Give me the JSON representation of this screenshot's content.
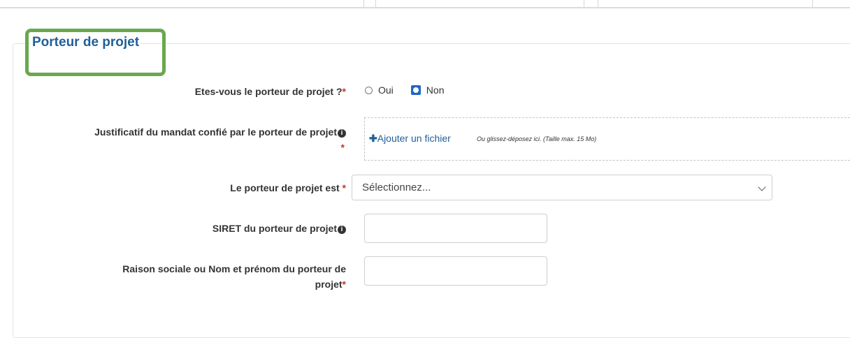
{
  "section": {
    "title": "Porteur de projet"
  },
  "fields": {
    "is_porteur": {
      "label": "Etes-vous le porteur de projet ?",
      "required_mark": "*",
      "options": [
        {
          "label": "Oui",
          "checked": false
        },
        {
          "label": "Non",
          "checked": true
        }
      ]
    },
    "justificatif": {
      "label": "Justificatif du mandat confié par le porteur de projet",
      "required_mark": "*",
      "add_file_label": "Ajouter un fichier",
      "add_file_icon": "plus-icon",
      "drop_hint": "Ou glissez-déposez ici. (Taille max. 15 Mo)"
    },
    "porteur_type": {
      "label": "Le porteur de projet est",
      "required_mark": "*",
      "select_value": "Sélectionnez..."
    },
    "siret": {
      "label": "SIRET du porteur de projet",
      "value": ""
    },
    "raison_sociale": {
      "label_line1": "Raison sociale ou Nom et prénom du porteur de",
      "label_line2": "projet",
      "required_mark": "*",
      "value": ""
    }
  },
  "colors": {
    "highlight": "#6aa84f",
    "title": "#1f5f9a",
    "required": "#c0392b",
    "radio_checked": "#1f67c9"
  }
}
